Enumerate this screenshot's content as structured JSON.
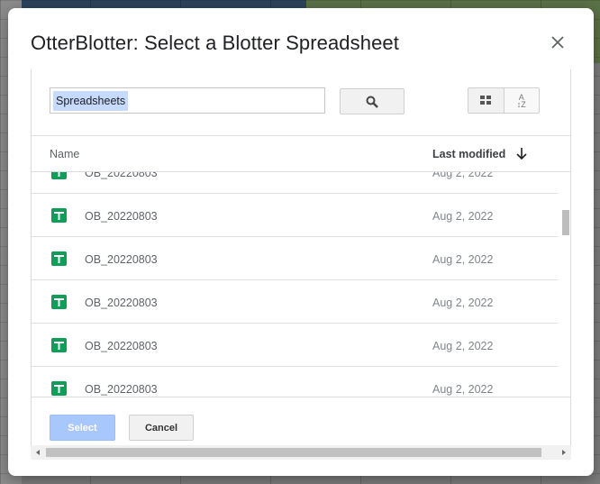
{
  "dialog": {
    "title": "OtterBlotter: Select a Blotter Spreadsheet"
  },
  "search": {
    "value": "Spreadsheets"
  },
  "columns": {
    "name": "Name",
    "last_modified": "Last modified"
  },
  "files": [
    {
      "name": "OB_20220803",
      "date": "Aug 2, 2022"
    },
    {
      "name": "OB_20220803",
      "date": "Aug 2, 2022"
    },
    {
      "name": "OB_20220803",
      "date": "Aug 2, 2022"
    },
    {
      "name": "OB_20220803",
      "date": "Aug 2, 2022"
    },
    {
      "name": "OB_20220803",
      "date": "Aug 2, 2022"
    },
    {
      "name": "OB_20220803",
      "date": "Aug 2, 2022"
    }
  ],
  "buttons": {
    "select": "Select",
    "cancel": "Cancel"
  },
  "icons": {
    "close": "close-icon",
    "search": "search-icon",
    "grid": "grid-view-icon",
    "sort": "sort-az-icon",
    "sort_arrow": "arrow-down-icon",
    "file": "google-sheets-icon"
  },
  "colors": {
    "select_button": "#a8c7fa",
    "sheets_green": "#0f9d58",
    "search_highlight": "#c5dafd"
  }
}
